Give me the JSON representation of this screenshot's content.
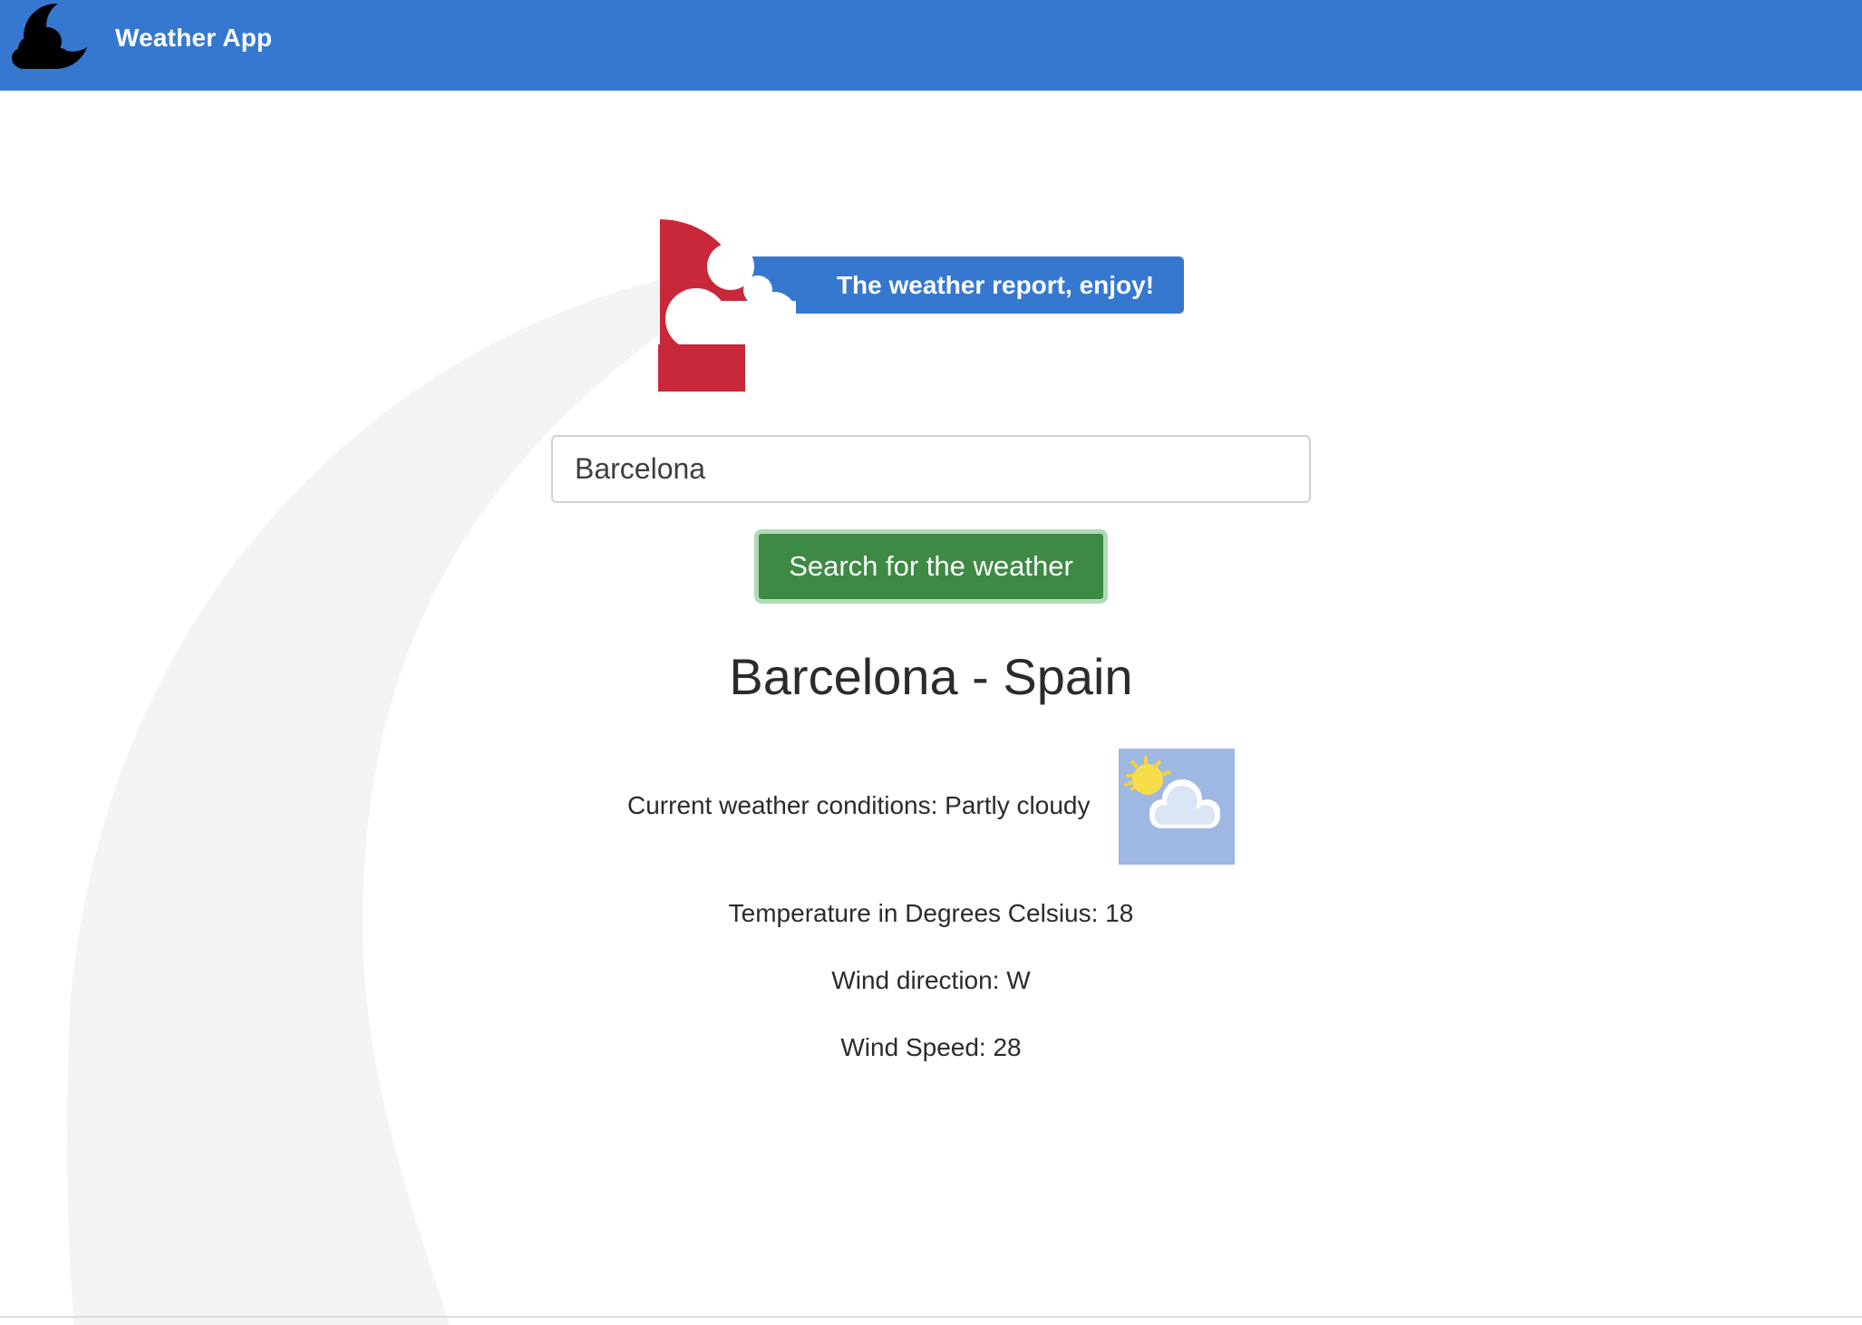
{
  "app": {
    "title": "Weather App",
    "logo_icon": "moon-cloud-icon",
    "accent_color": "#3678d0"
  },
  "hero": {
    "tagline": "The weather report, enjoy!",
    "icon": "cloud-logo-icon",
    "icon_color": "#c9283a"
  },
  "search": {
    "value": "Barcelona",
    "button_label": "Search for the weather",
    "button_color": "#3d8a45"
  },
  "result": {
    "location": "Barcelona - Spain",
    "conditions": "Current weather conditions: Partly cloudy",
    "conditions_icon": "partly-cloudy-icon",
    "temperature": "Temperature in Degrees Celsius: 18",
    "wind_direction": "Wind direction: W",
    "wind_speed": "Wind Speed: 28"
  }
}
